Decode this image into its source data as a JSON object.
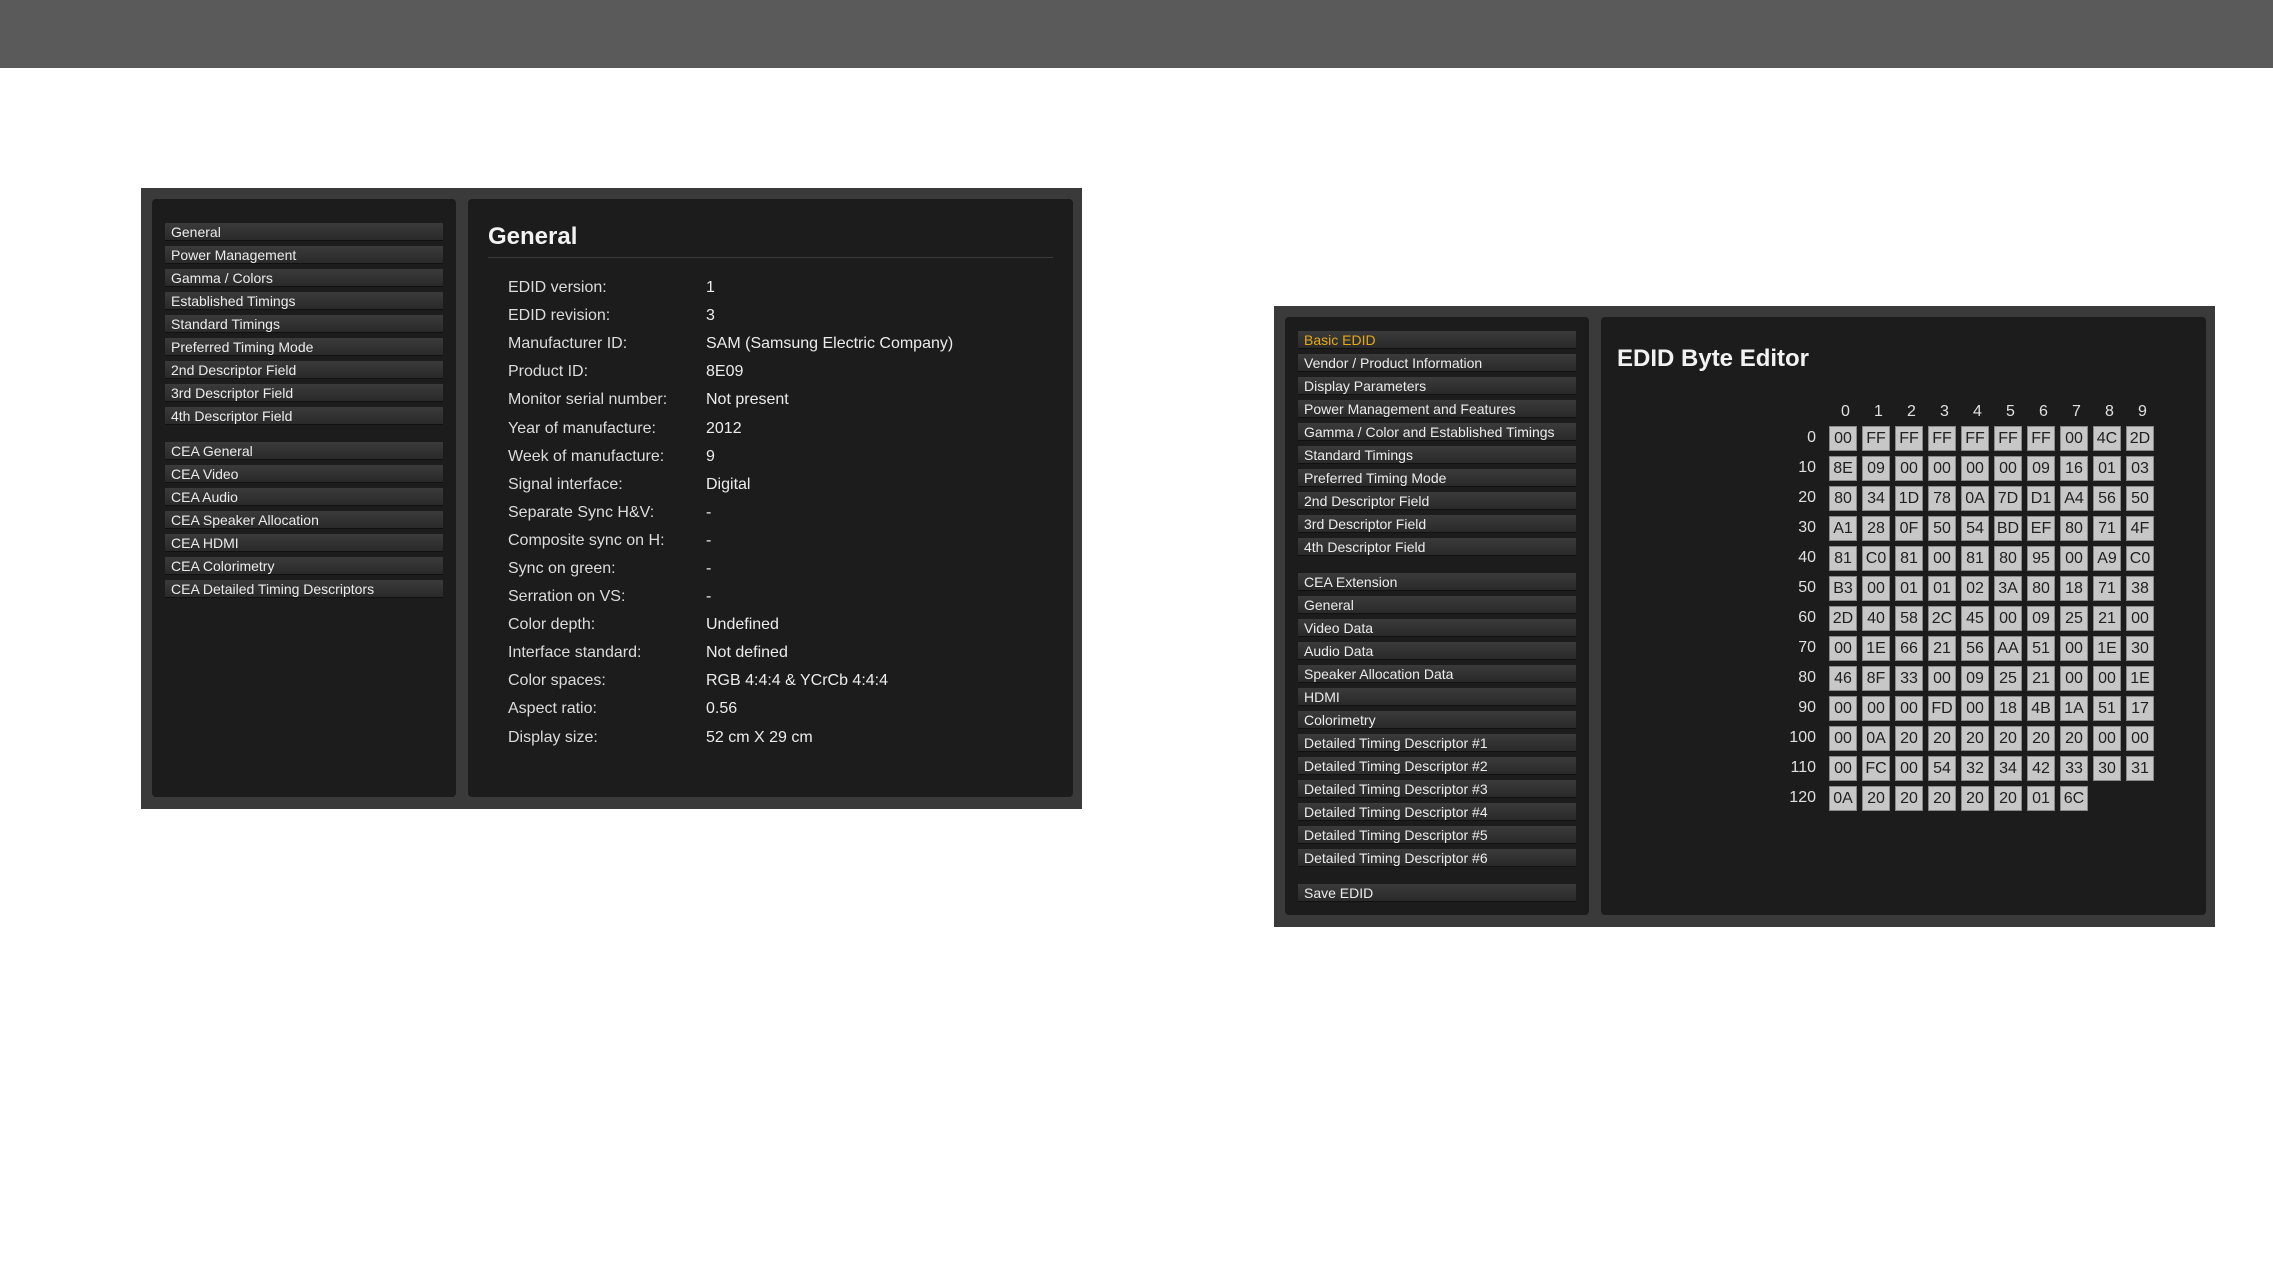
{
  "general_panel": {
    "menu_group1": [
      "General",
      "Power Management",
      "Gamma / Colors",
      "Established Timings",
      "Standard Timings",
      "Preferred Timing Mode",
      "2nd Descriptor Field",
      "3rd Descriptor Field",
      "4th Descriptor Field"
    ],
    "menu_group2": [
      "CEA General",
      "CEA Video",
      "CEA Audio",
      "CEA Speaker Allocation",
      "CEA HDMI",
      "CEA Colorimetry",
      "CEA Detailed Timing Descriptors"
    ],
    "title": "General",
    "fields": [
      {
        "label": "EDID version:",
        "value": "1"
      },
      {
        "label": "EDID revision:",
        "value": "3"
      },
      {
        "label": "Manufacturer ID:",
        "value": "SAM (Samsung Electric Company)"
      },
      {
        "label": "Product ID:",
        "value": "8E09"
      },
      {
        "label": "Monitor serial number:",
        "value": "Not present"
      },
      {
        "label": "Year of manufacture:",
        "value": "2012"
      },
      {
        "label": "Week of manufacture:",
        "value": "9"
      },
      {
        "label": "Signal interface:",
        "value": "Digital"
      },
      {
        "label": "Separate Sync H&V:",
        "value": "-"
      },
      {
        "label": "Composite sync on H:",
        "value": "-"
      },
      {
        "label": "Sync on green:",
        "value": "-"
      },
      {
        "label": "Serration on VS:",
        "value": "-"
      },
      {
        "label": "Color depth:",
        "value": "Undefined"
      },
      {
        "label": "Interface standard:",
        "value": "Not defined"
      },
      {
        "label": "Color spaces:",
        "value": "RGB 4:4:4 & YCrCb 4:4:4"
      },
      {
        "label": "Aspect ratio:",
        "value": "0.56"
      },
      {
        "label": "Display size:",
        "value": "52 cm X 29 cm"
      }
    ]
  },
  "byte_editor_panel": {
    "active_color": "#e6a817",
    "menu_group1": [
      "Basic EDID",
      "Vendor / Product Information",
      "Display Parameters",
      "Power Management and Features",
      "Gamma / Color and Established Timings",
      "Standard Timings",
      "Preferred Timing Mode",
      "2nd Descriptor Field",
      "3rd Descriptor Field",
      "4th Descriptor Field"
    ],
    "menu_group2": [
      "CEA Extension",
      "General",
      "Video Data",
      "Audio Data",
      "Speaker Allocation Data",
      "HDMI",
      "Colorimetry",
      "Detailed Timing Descriptor #1",
      "Detailed Timing Descriptor #2",
      "Detailed Timing Descriptor #3",
      "Detailed Timing Descriptor #4",
      "Detailed Timing Descriptor #5",
      "Detailed Timing Descriptor #6"
    ],
    "menu_group3": [
      "Save EDID"
    ],
    "title": "EDID Byte Editor",
    "column_headers": [
      "0",
      "1",
      "2",
      "3",
      "4",
      "5",
      "6",
      "7",
      "8",
      "9"
    ],
    "rows": [
      {
        "label": "0",
        "bytes": [
          "00",
          "FF",
          "FF",
          "FF",
          "FF",
          "FF",
          "FF",
          "00",
          "4C",
          "2D"
        ]
      },
      {
        "label": "10",
        "bytes": [
          "8E",
          "09",
          "00",
          "00",
          "00",
          "00",
          "09",
          "16",
          "01",
          "03"
        ]
      },
      {
        "label": "20",
        "bytes": [
          "80",
          "34",
          "1D",
          "78",
          "0A",
          "7D",
          "D1",
          "A4",
          "56",
          "50"
        ]
      },
      {
        "label": "30",
        "bytes": [
          "A1",
          "28",
          "0F",
          "50",
          "54",
          "BD",
          "EF",
          "80",
          "71",
          "4F"
        ]
      },
      {
        "label": "40",
        "bytes": [
          "81",
          "C0",
          "81",
          "00",
          "81",
          "80",
          "95",
          "00",
          "A9",
          "C0"
        ]
      },
      {
        "label": "50",
        "bytes": [
          "B3",
          "00",
          "01",
          "01",
          "02",
          "3A",
          "80",
          "18",
          "71",
          "38"
        ]
      },
      {
        "label": "60",
        "bytes": [
          "2D",
          "40",
          "58",
          "2C",
          "45",
          "00",
          "09",
          "25",
          "21",
          "00"
        ]
      },
      {
        "label": "70",
        "bytes": [
          "00",
          "1E",
          "66",
          "21",
          "56",
          "AA",
          "51",
          "00",
          "1E",
          "30"
        ]
      },
      {
        "label": "80",
        "bytes": [
          "46",
          "8F",
          "33",
          "00",
          "09",
          "25",
          "21",
          "00",
          "00",
          "1E"
        ]
      },
      {
        "label": "90",
        "bytes": [
          "00",
          "00",
          "00",
          "FD",
          "00",
          "18",
          "4B",
          "1A",
          "51",
          "17"
        ]
      },
      {
        "label": "100",
        "bytes": [
          "00",
          "0A",
          "20",
          "20",
          "20",
          "20",
          "20",
          "20",
          "00",
          "00"
        ]
      },
      {
        "label": "110",
        "bytes": [
          "00",
          "FC",
          "00",
          "54",
          "32",
          "34",
          "42",
          "33",
          "30",
          "31"
        ]
      },
      {
        "label": "120",
        "bytes": [
          "0A",
          "20",
          "20",
          "20",
          "20",
          "20",
          "01",
          "6C"
        ]
      }
    ]
  }
}
